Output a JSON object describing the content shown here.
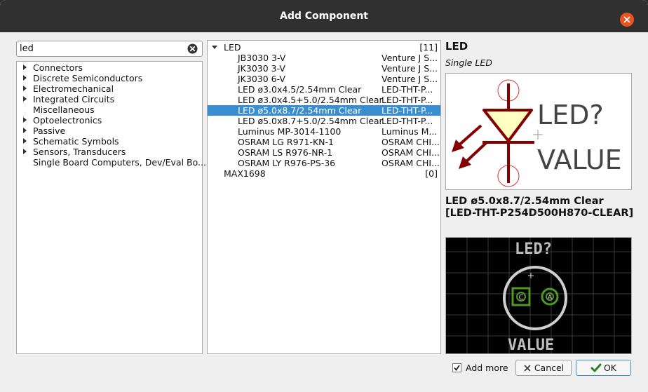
{
  "window": {
    "title": "Add Component"
  },
  "search": {
    "value": "led"
  },
  "libraries": [
    {
      "label": "Connectors",
      "expandable": true
    },
    {
      "label": "Discrete Semiconductors",
      "expandable": true
    },
    {
      "label": "Electromechanical",
      "expandable": true
    },
    {
      "label": "Integrated Circuits",
      "expandable": true
    },
    {
      "label": "Miscellaneous",
      "expandable": false
    },
    {
      "label": "Optoelectronics",
      "expandable": true
    },
    {
      "label": "Passive",
      "expandable": true
    },
    {
      "label": "Schematic Symbols",
      "expandable": true
    },
    {
      "label": "Sensors, Transducers",
      "expandable": true
    },
    {
      "label": "Single Board Computers, Dev/Eval Bo...",
      "expandable": false
    }
  ],
  "components": {
    "groups": [
      {
        "name": "LED",
        "count": "[11]",
        "expanded": true,
        "items": [
          {
            "name": "JB3030 3-V",
            "desc": "Venture J S..."
          },
          {
            "name": "JK3030 3-V",
            "desc": "Venture J S..."
          },
          {
            "name": "JK3030 6-V",
            "desc": "Venture J S..."
          },
          {
            "name": "LED ø3.0x4.5/2.54mm Clear",
            "desc": "LED-THT-P..."
          },
          {
            "name": "LED ø3.0x4.5+5.0/2.54mm Clear",
            "desc": "LED-THT-P..."
          },
          {
            "name": "LED ø5.0x8.7/2.54mm Clear",
            "desc": "LED-THT-P...",
            "selected": true
          },
          {
            "name": "LED ø5.0x8.7+5.0/2.54mm Clear",
            "desc": "LED-THT-P..."
          },
          {
            "name": "Luminus MP-3014-1100",
            "desc": "Luminus M..."
          },
          {
            "name": "OSRAM LG R971-KN-1",
            "desc": "OSRAM CHI..."
          },
          {
            "name": "OSRAM LS R976-NR-1",
            "desc": "OSRAM CHI..."
          },
          {
            "name": "OSRAM LY R976-PS-36",
            "desc": "OSRAM CHI..."
          }
        ]
      },
      {
        "name": "MAX1698",
        "count": "[0]",
        "expanded": false,
        "items": []
      }
    ]
  },
  "symbol": {
    "title": "LED",
    "description": "Single LED",
    "ref_text": "LED?",
    "value_text": "VALUE"
  },
  "footprint": {
    "title": "LED ø5.0x8.7/2.54mm Clear [LED-THT-P254D500H870-CLEAR]",
    "ref_text": "LED?",
    "value_text": "VALUE",
    "pad_c": "C",
    "pad_a": "A"
  },
  "footer": {
    "add_more_label": "Add more",
    "add_more_checked": true,
    "cancel_label": "Cancel",
    "ok_label": "OK"
  },
  "colors": {
    "selection": "#3a8ed0",
    "symbol_body": "#840000",
    "symbol_fill": "#ffffc2",
    "arrow": "#840000",
    "fp_silk": "#cfcfcf",
    "fp_pad": "#4c9a20",
    "close_button": "#e95420"
  }
}
